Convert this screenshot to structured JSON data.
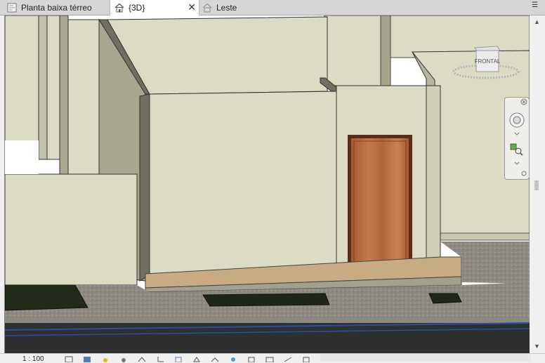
{
  "tabs": [
    {
      "label": "Planta baixa térreo",
      "active": false
    },
    {
      "label": "{3D}",
      "active": true
    },
    {
      "label": "Leste",
      "active": false
    }
  ],
  "viewcube": {
    "face_label": "FRONTAL"
  },
  "status": {
    "scale": "1 : 100"
  },
  "colors": {
    "wall": "#dcdcc4",
    "wall_shadow": "#a7a790",
    "door_wood": "#b66a3c",
    "floor_gravel": "#8f8b83",
    "tab_active": "#ffffff"
  },
  "icons": [
    "house-icon",
    "plan-view-icon",
    "close-icon",
    "dropdown-icon",
    "zoom-icon",
    "steering-wheel-icon",
    "sun-icon",
    "shadow-icon"
  ]
}
